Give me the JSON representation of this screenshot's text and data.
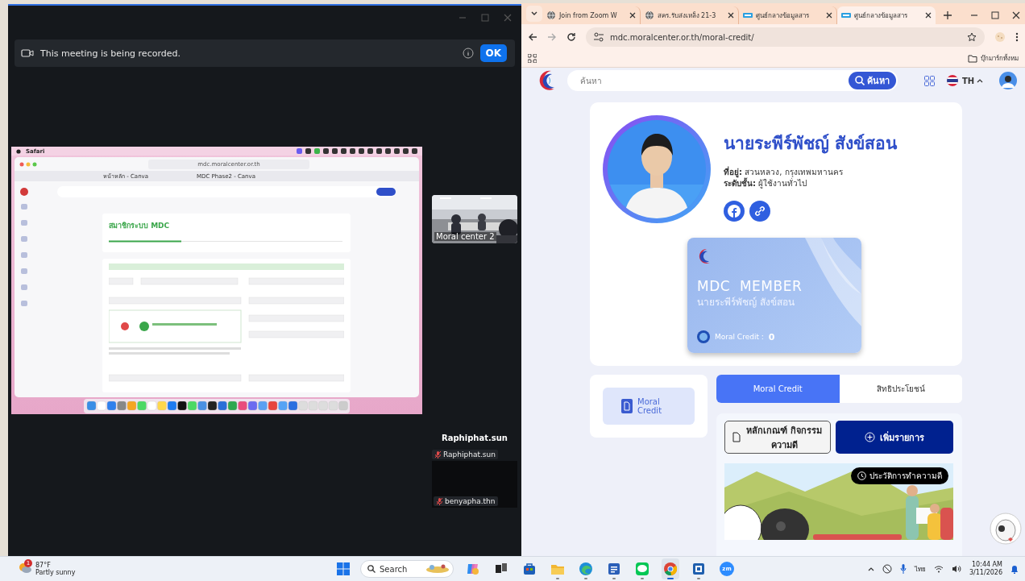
{
  "zoom": {
    "banner": {
      "text": "This meeting is being recorded.",
      "button": "OK"
    },
    "shared_screen": {
      "menu_app": "Safari",
      "url": "mdc.moralcenter.or.th",
      "tabs": [
        {
          "label": "หน้าหลัก - Canva",
          "selected": false
        },
        {
          "label": "MDC Phase2 - Canva",
          "selected": false
        }
      ],
      "page_title": "สมาชิกระบบ MDC"
    },
    "participants": {
      "video_label": "Moral center 2",
      "speaker": "Raphiphat.sun",
      "tiles": [
        {
          "name": "Raphiphat.sun",
          "muted": true
        },
        {
          "name": "benyapha.thn",
          "muted": true
        }
      ]
    }
  },
  "browser": {
    "tabs": [
      {
        "title": "Join from Zoom W",
        "kind": "globe",
        "selected": false
      },
      {
        "title": "สคร.รับส่งเหล็ง 21-3",
        "kind": "globe",
        "selected": false
      },
      {
        "title": "ศูนย์กลางข้อมูลสาร",
        "kind": "site",
        "selected": false
      },
      {
        "title": "ศูนย์กลางข้อมูลสาร",
        "kind": "site",
        "selected": true
      }
    ],
    "url": "mdc.moralcenter.or.th/moral-credit/",
    "bookmark_folder": "บุ๊กมาร์กทั้งหม"
  },
  "page": {
    "search": {
      "placeholder": "ค้นหา",
      "button": "ค้นหา"
    },
    "language": "TH",
    "profile": {
      "name": "นายระพีร์พัชญ์ สังข์สอน",
      "fields": [
        "**ที่อยู่:** สวนหลวง, กรุงเทพมหานคร",
        "**ระดับชั้น:** ผู้ใช้งานทั่วไป"
      ]
    },
    "member_card": {
      "title": "MDC  MEMBER",
      "name": "นายระพีร์พัชญ์ สังข์สอน",
      "credit_label": "Moral Credit :",
      "credit": "0"
    },
    "side_menu": [
      {
        "label": "Moral Credit",
        "selected": true
      }
    ],
    "tabs": [
      {
        "label": "Moral Credit",
        "selected": true
      },
      {
        "label": "สิทธิประโยชน์",
        "selected": false
      }
    ],
    "actions": [
      {
        "label": "หลักเกณฑ์ กิจกรรม ความดี",
        "kind": "outline"
      },
      {
        "label": "เพิ่มรายการ",
        "kind": "primary"
      }
    ],
    "banner_badge": "ประวัติการทำความดี"
  },
  "taskbar": {
    "weather": {
      "temperature": "87°F",
      "condition": "Partly sunny",
      "badge": "1"
    },
    "search": {
      "placeholder": "Search"
    },
    "apps": [
      {
        "kind": "copilot",
        "running": false,
        "selected": false
      },
      {
        "kind": "taskview",
        "running": false,
        "selected": false
      },
      {
        "kind": "store",
        "running": false,
        "selected": false
      },
      {
        "kind": "explorer",
        "running": true,
        "selected": false
      },
      {
        "kind": "edge",
        "running": true,
        "selected": false
      },
      {
        "kind": "word",
        "running": true,
        "selected": false
      },
      {
        "kind": "line",
        "running": true,
        "selected": false
      },
      {
        "kind": "chrome",
        "running": true,
        "selected": true
      },
      {
        "kind": "app",
        "running": true,
        "selected": false
      },
      {
        "kind": "zoom",
        "running": false,
        "selected": false,
        "label": "zm"
      }
    ],
    "language": "ไทย",
    "time": "10:44 AM",
    "date": "3/11/2026"
  }
}
